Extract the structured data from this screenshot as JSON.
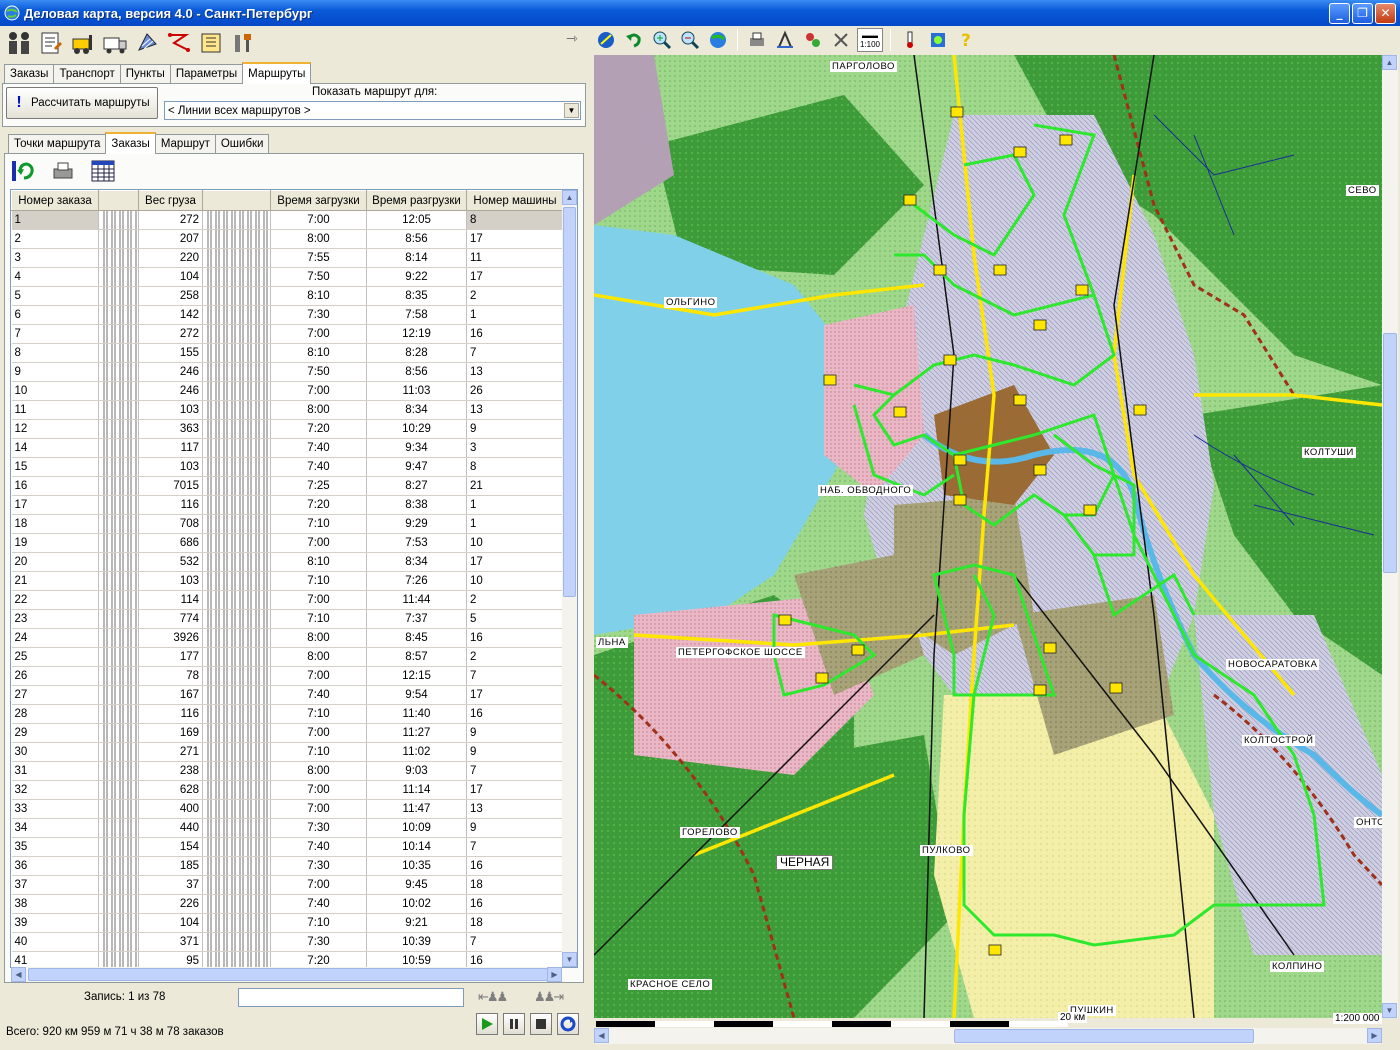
{
  "window": {
    "title": "Деловая карта, версия 4.0 - Санкт-Петербург",
    "controls": [
      "_",
      "❐",
      "✕"
    ]
  },
  "main_tabs": [
    "Заказы",
    "Транспорт",
    "Пункты",
    "Параметры",
    "Маршруты"
  ],
  "active_main_tab": "Маршруты",
  "routes_panel": {
    "calculate_button": "Рассчитать маршруты",
    "show_route_label": "Показать маршрут для:",
    "route_select_value": "< Линии всех маршрутов >"
  },
  "sub_tabs": [
    "Точки маршрута",
    "Заказы",
    "Маршрут",
    "Ошибки"
  ],
  "active_sub_tab": "Заказы",
  "table": {
    "columns": [
      "Номер заказа",
      "Вес груза",
      "Время загрузки",
      "Время разгрузки",
      "Номер машины"
    ],
    "rows": [
      [
        "1",
        "272",
        "7:00",
        "12:05",
        "8"
      ],
      [
        "2",
        "207",
        "8:00",
        "8:56",
        "17"
      ],
      [
        "3",
        "220",
        "7:55",
        "8:14",
        "11"
      ],
      [
        "4",
        "104",
        "7:50",
        "9:22",
        "17"
      ],
      [
        "5",
        "258",
        "8:10",
        "8:35",
        "2"
      ],
      [
        "6",
        "142",
        "7:30",
        "7:58",
        "1"
      ],
      [
        "7",
        "272",
        "7:00",
        "12:19",
        "16"
      ],
      [
        "8",
        "155",
        "8:10",
        "8:28",
        "7"
      ],
      [
        "9",
        "246",
        "7:50",
        "8:56",
        "13"
      ],
      [
        "10",
        "246",
        "7:00",
        "11:03",
        "26"
      ],
      [
        "11",
        "103",
        "8:00",
        "8:34",
        "13"
      ],
      [
        "12",
        "363",
        "7:20",
        "10:29",
        "9"
      ],
      [
        "14",
        "117",
        "7:40",
        "9:34",
        "3"
      ],
      [
        "15",
        "103",
        "7:40",
        "9:47",
        "8"
      ],
      [
        "16",
        "7015",
        "7:25",
        "8:27",
        "21"
      ],
      [
        "17",
        "116",
        "7:20",
        "8:38",
        "1"
      ],
      [
        "18",
        "708",
        "7:10",
        "9:29",
        "1"
      ],
      [
        "19",
        "686",
        "7:00",
        "7:53",
        "10"
      ],
      [
        "20",
        "532",
        "8:10",
        "8:34",
        "17"
      ],
      [
        "21",
        "103",
        "7:10",
        "7:26",
        "10"
      ],
      [
        "22",
        "114",
        "7:00",
        "11:44",
        "2"
      ],
      [
        "23",
        "774",
        "7:10",
        "7:37",
        "5"
      ],
      [
        "24",
        "3926",
        "8:00",
        "8:45",
        "16"
      ],
      [
        "25",
        "177",
        "8:00",
        "8:57",
        "2"
      ],
      [
        "26",
        "78",
        "7:00",
        "12:15",
        "7"
      ],
      [
        "27",
        "167",
        "7:40",
        "9:54",
        "17"
      ],
      [
        "28",
        "116",
        "7:10",
        "11:40",
        "16"
      ],
      [
        "29",
        "169",
        "7:00",
        "11:27",
        "9"
      ],
      [
        "30",
        "271",
        "7:10",
        "11:02",
        "9"
      ],
      [
        "31",
        "238",
        "8:00",
        "9:03",
        "7"
      ],
      [
        "32",
        "628",
        "7:00",
        "11:14",
        "17"
      ],
      [
        "33",
        "400",
        "7:00",
        "11:47",
        "13"
      ],
      [
        "34",
        "440",
        "7:30",
        "10:09",
        "9"
      ],
      [
        "35",
        "154",
        "7:40",
        "10:14",
        "7"
      ],
      [
        "36",
        "185",
        "7:30",
        "10:35",
        "16"
      ],
      [
        "37",
        "37",
        "7:00",
        "9:45",
        "18"
      ],
      [
        "38",
        "226",
        "7:40",
        "10:02",
        "16"
      ],
      [
        "39",
        "104",
        "7:10",
        "9:21",
        "18"
      ],
      [
        "40",
        "371",
        "7:30",
        "10:39",
        "7"
      ],
      [
        "41",
        "95",
        "7:20",
        "10:59",
        "16"
      ]
    ]
  },
  "record_label": "Запись: 1 из 78",
  "status": "Всего: 920 км 959 м  71 ч 38 м  78 заказов",
  "map": {
    "scale_label": "20 км",
    "ratio_label": "1:200 000",
    "scale_button": "1:100",
    "places": [
      "ПАРГОЛОВО",
      "ОЛЬГИНО",
      "КОЛТУШИ",
      "НОВОСАРАТОВКА",
      "ГОРЕЛОВО",
      "ЧЕРНАЯ",
      "ПУЛКОВО",
      "КОЛПИНО",
      "ПУШКИН",
      "КРАСНОЕ СЕЛО",
      "СЕВО",
      "КОЛТОСТРОЙ",
      "ЛЬНА",
      "ПЕТЕРГОФСКОЕ ШОССЕ",
      "НАБ. ОБВОДНОГО",
      "ОНТО"
    ]
  }
}
